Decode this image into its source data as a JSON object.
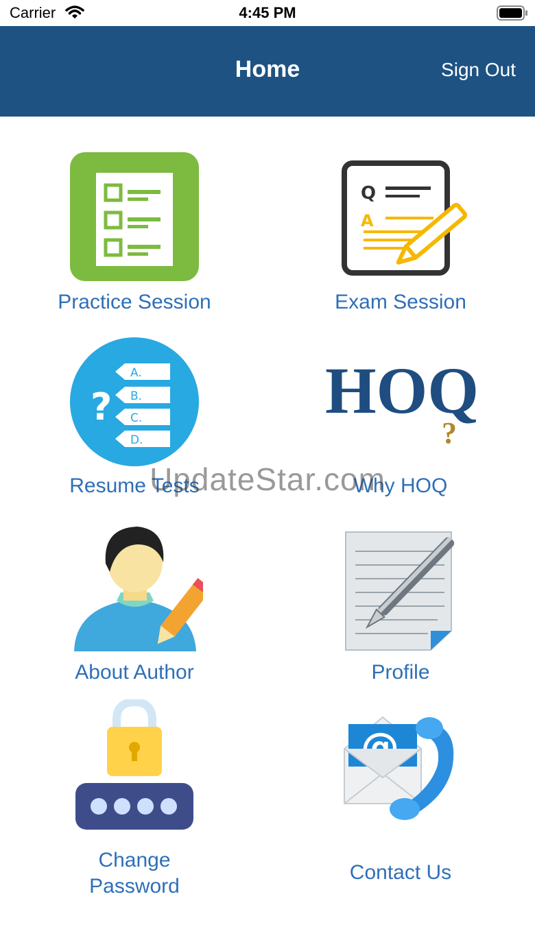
{
  "status_bar": {
    "carrier": "Carrier",
    "time": "4:45 PM"
  },
  "nav": {
    "title": "Home",
    "sign_out": "Sign Out"
  },
  "tiles": [
    {
      "label": "Practice Session",
      "icon": "checklist-icon"
    },
    {
      "label": "Exam Session",
      "icon": "exam-pencil-icon"
    },
    {
      "label": "Resume Tests",
      "icon": "quiz-options-icon"
    },
    {
      "label": "Why HOQ",
      "icon": "hoq-logo-icon",
      "logo_text": "HOQ"
    },
    {
      "label": "About Author",
      "icon": "author-icon"
    },
    {
      "label": "Profile",
      "icon": "notepad-pen-icon"
    },
    {
      "label": "Change Password",
      "icon": "lock-password-icon"
    },
    {
      "label": "Contact Us",
      "icon": "email-phone-icon"
    }
  ],
  "watermark": "UpdateStar.com",
  "colors": {
    "nav_bg": "#1e5282",
    "label": "#2e6fb8"
  }
}
